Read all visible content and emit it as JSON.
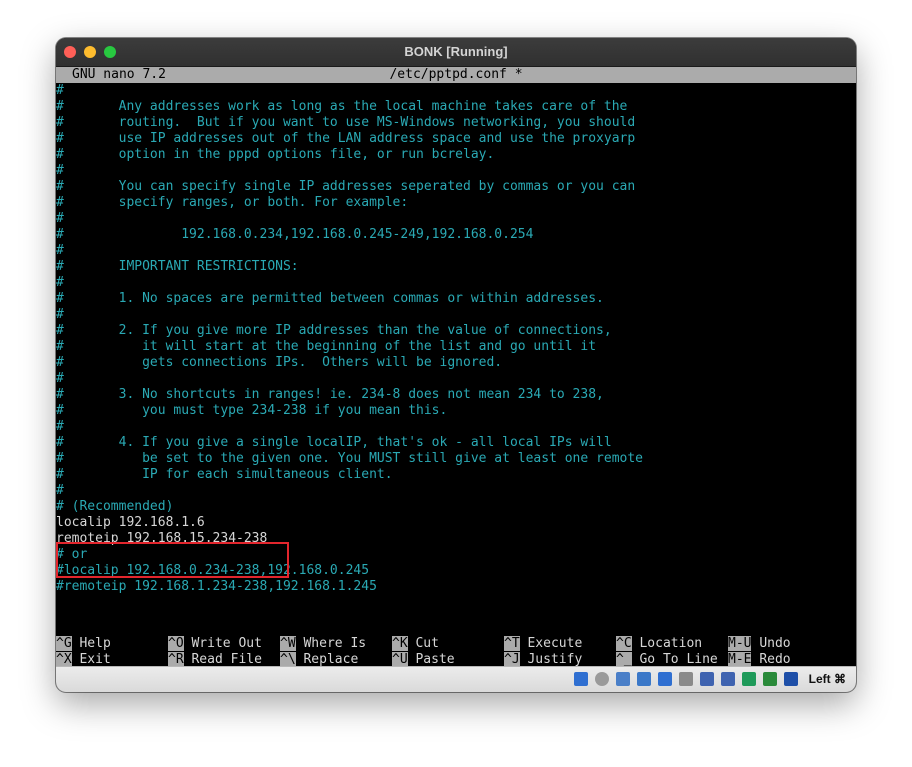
{
  "window": {
    "title": "BONK [Running]"
  },
  "nano": {
    "version": "GNU nano 7.2",
    "filename": "/etc/pptpd.conf *"
  },
  "lines": [
    "#",
    "#       Any addresses work as long as the local machine takes care of the",
    "#       routing.  But if you want to use MS-Windows networking, you should",
    "#       use IP addresses out of the LAN address space and use the proxyarp",
    "#       option in the pppd options file, or run bcrelay.",
    "#",
    "#       You can specify single IP addresses seperated by commas or you can",
    "#       specify ranges, or both. For example:",
    "#",
    "#               192.168.0.234,192.168.0.245-249,192.168.0.254",
    "#",
    "#       IMPORTANT RESTRICTIONS:",
    "#",
    "#       1. No spaces are permitted between commas or within addresses.",
    "#",
    "#       2. If you give more IP addresses than the value of connections,",
    "#          it will start at the beginning of the list and go until it",
    "#          gets connections IPs.  Others will be ignored.",
    "#",
    "#       3. No shortcuts in ranges! ie. 234-8 does not mean 234 to 238,",
    "#          you must type 234-238 if you mean this.",
    "#",
    "#       4. If you give a single localIP, that's ok - all local IPs will",
    "#          be set to the given one. You MUST still give at least one remote",
    "#          IP for each simultaneous client.",
    "#",
    "# (Recommended)",
    "localip 192.168.1.6",
    {
      "pre": "remoteip ",
      "cursor": "1",
      "post": "92.168.15.234-238"
    },
    "# or",
    "#localip 192.168.0.234-238,192.168.0.245",
    "#remoteip 192.168.1.234-238,192.168.1.245"
  ],
  "plain_lines": [
    27,
    28
  ],
  "shortcuts": [
    {
      "key": "^G",
      "label": "Help"
    },
    {
      "key": "^X",
      "label": "Exit"
    },
    {
      "key": "^O",
      "label": "Write Out"
    },
    {
      "key": "^R",
      "label": "Read File"
    },
    {
      "key": "^W",
      "label": "Where Is"
    },
    {
      "key": "^\\",
      "label": "Replace"
    },
    {
      "key": "^K",
      "label": "Cut"
    },
    {
      "key": "^U",
      "label": "Paste"
    },
    {
      "key": "^T",
      "label": "Execute"
    },
    {
      "key": "^J",
      "label": "Justify"
    },
    {
      "key": "^C",
      "label": "Location"
    },
    {
      "key": "^_",
      "label": "Go To Line"
    },
    {
      "key": "M-U",
      "label": "Undo"
    },
    {
      "key": "M-E",
      "label": "Redo"
    }
  ],
  "statusbar": {
    "host_key": "Left ⌘",
    "icons": [
      {
        "name": "hard-disk-icon",
        "color": "#2f6fd1"
      },
      {
        "name": "optical-drive-icon",
        "color": "#9a9a9a"
      },
      {
        "name": "audio-icon",
        "color": "#4a7fc8"
      },
      {
        "name": "network-icon",
        "color": "#3b78c8"
      },
      {
        "name": "usb-icon",
        "color": "#2f6fd1"
      },
      {
        "name": "shared-folder-icon",
        "color": "#8a8a8a"
      },
      {
        "name": "display-icon",
        "color": "#3f63b0"
      },
      {
        "name": "video-capture-icon",
        "color": "#3f63b0"
      },
      {
        "name": "recording-icon",
        "color": "#1f9a5a"
      },
      {
        "name": "cpu-icon",
        "color": "#2a8a3a"
      },
      {
        "name": "mouse-integration-icon",
        "color": "#1e4fa8"
      }
    ]
  }
}
